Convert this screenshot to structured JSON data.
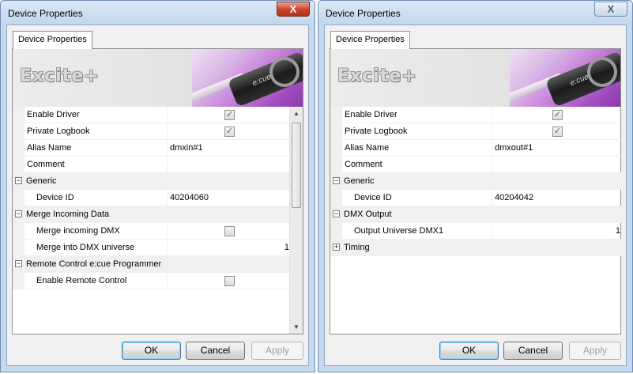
{
  "left_dialog": {
    "title": "Device Properties",
    "close_label": "X",
    "tab": "Device Properties",
    "brand": "Excite+",
    "photo_label": "e:cue",
    "rows": [
      {
        "type": "prop",
        "name": "Enable Driver",
        "checked": true
      },
      {
        "type": "prop",
        "name": "Private Logbook",
        "checked": true
      },
      {
        "type": "prop",
        "name": "Alias Name",
        "value": "dmxin#1"
      },
      {
        "type": "prop",
        "name": "Comment",
        "value": ""
      },
      {
        "type": "category",
        "name": "Generic",
        "expander": "−"
      },
      {
        "type": "prop",
        "indent": true,
        "name": "Device ID",
        "value": "40204060"
      },
      {
        "type": "category",
        "name": "Merge Incoming Data",
        "expander": "−"
      },
      {
        "type": "prop",
        "indent": true,
        "name": "Merge incoming DMX",
        "checked": false
      },
      {
        "type": "prop",
        "indent": true,
        "name": "Merge into DMX universe",
        "number": "1"
      },
      {
        "type": "category",
        "name": "Remote Control e:cue Programmer",
        "expander": "−"
      },
      {
        "type": "prop",
        "indent": true,
        "name": "Enable Remote Control",
        "checked": false
      }
    ],
    "buttons": {
      "ok": "OK",
      "cancel": "Cancel",
      "apply": "Apply"
    }
  },
  "right_dialog": {
    "title": "Device Properties",
    "close_label": "X",
    "tab": "Device Properties",
    "brand": "Excite+",
    "photo_label": "e:cue",
    "rows": [
      {
        "type": "prop",
        "name": "Enable Driver",
        "checked": true
      },
      {
        "type": "prop",
        "name": "Private Logbook",
        "checked": true
      },
      {
        "type": "prop",
        "name": "Alias Name",
        "value": "dmxout#1"
      },
      {
        "type": "prop",
        "name": "Comment",
        "value": ""
      },
      {
        "type": "category",
        "name": "Generic",
        "expander": "−"
      },
      {
        "type": "prop",
        "indent": true,
        "name": "Device ID",
        "value": "40204042"
      },
      {
        "type": "category",
        "name": "DMX Output",
        "expander": "−"
      },
      {
        "type": "prop",
        "indent": true,
        "name": "Output Universe DMX1",
        "number": "1"
      },
      {
        "type": "category",
        "name": "Timing",
        "expander": "+"
      }
    ],
    "buttons": {
      "ok": "OK",
      "cancel": "Cancel",
      "apply": "Apply"
    }
  },
  "checkmark_glyph": "✓"
}
